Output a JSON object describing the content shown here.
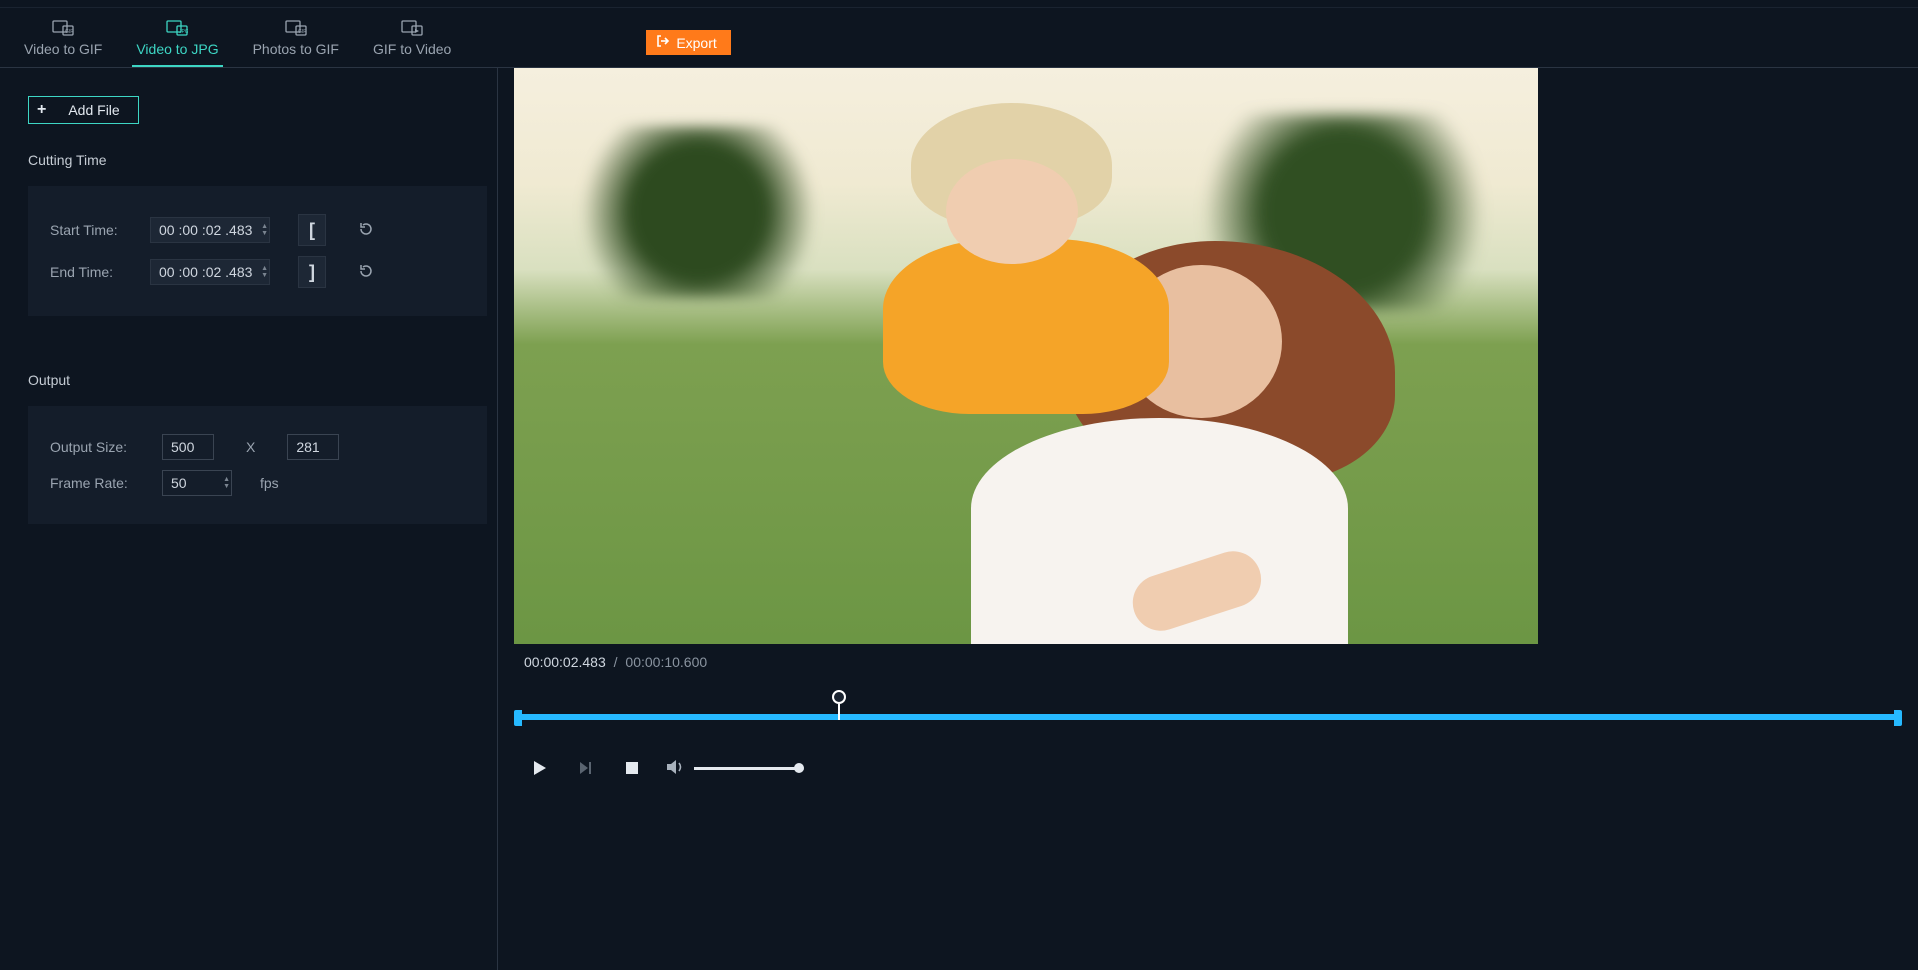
{
  "tabs": [
    {
      "label": "Video to GIF"
    },
    {
      "label": "Video to JPG"
    },
    {
      "label": "Photos to GIF"
    },
    {
      "label": "GIF to Video"
    }
  ],
  "activeTab": 1,
  "exportLabel": "Export",
  "addFileLabel": "Add File",
  "cuttingTime": {
    "title": "Cutting Time",
    "startLabel": "Start Time:",
    "endLabel": "End Time:",
    "startValue": "00 :00 :02 .483",
    "endValue": "00 :00 :02 .483",
    "bracketStart": "[",
    "bracketEnd": "]"
  },
  "output": {
    "title": "Output",
    "sizeLabel": "Output Size:",
    "width": "500",
    "height": "281",
    "sep": "X",
    "frameRateLabel": "Frame Rate:",
    "frameRate": "50",
    "fpsLabel": "fps"
  },
  "player": {
    "currentTime": "00:00:02.483",
    "separator": "/",
    "totalTime": "00:00:10.600",
    "playheadPercent": 23.4,
    "volumePercent": 95
  }
}
